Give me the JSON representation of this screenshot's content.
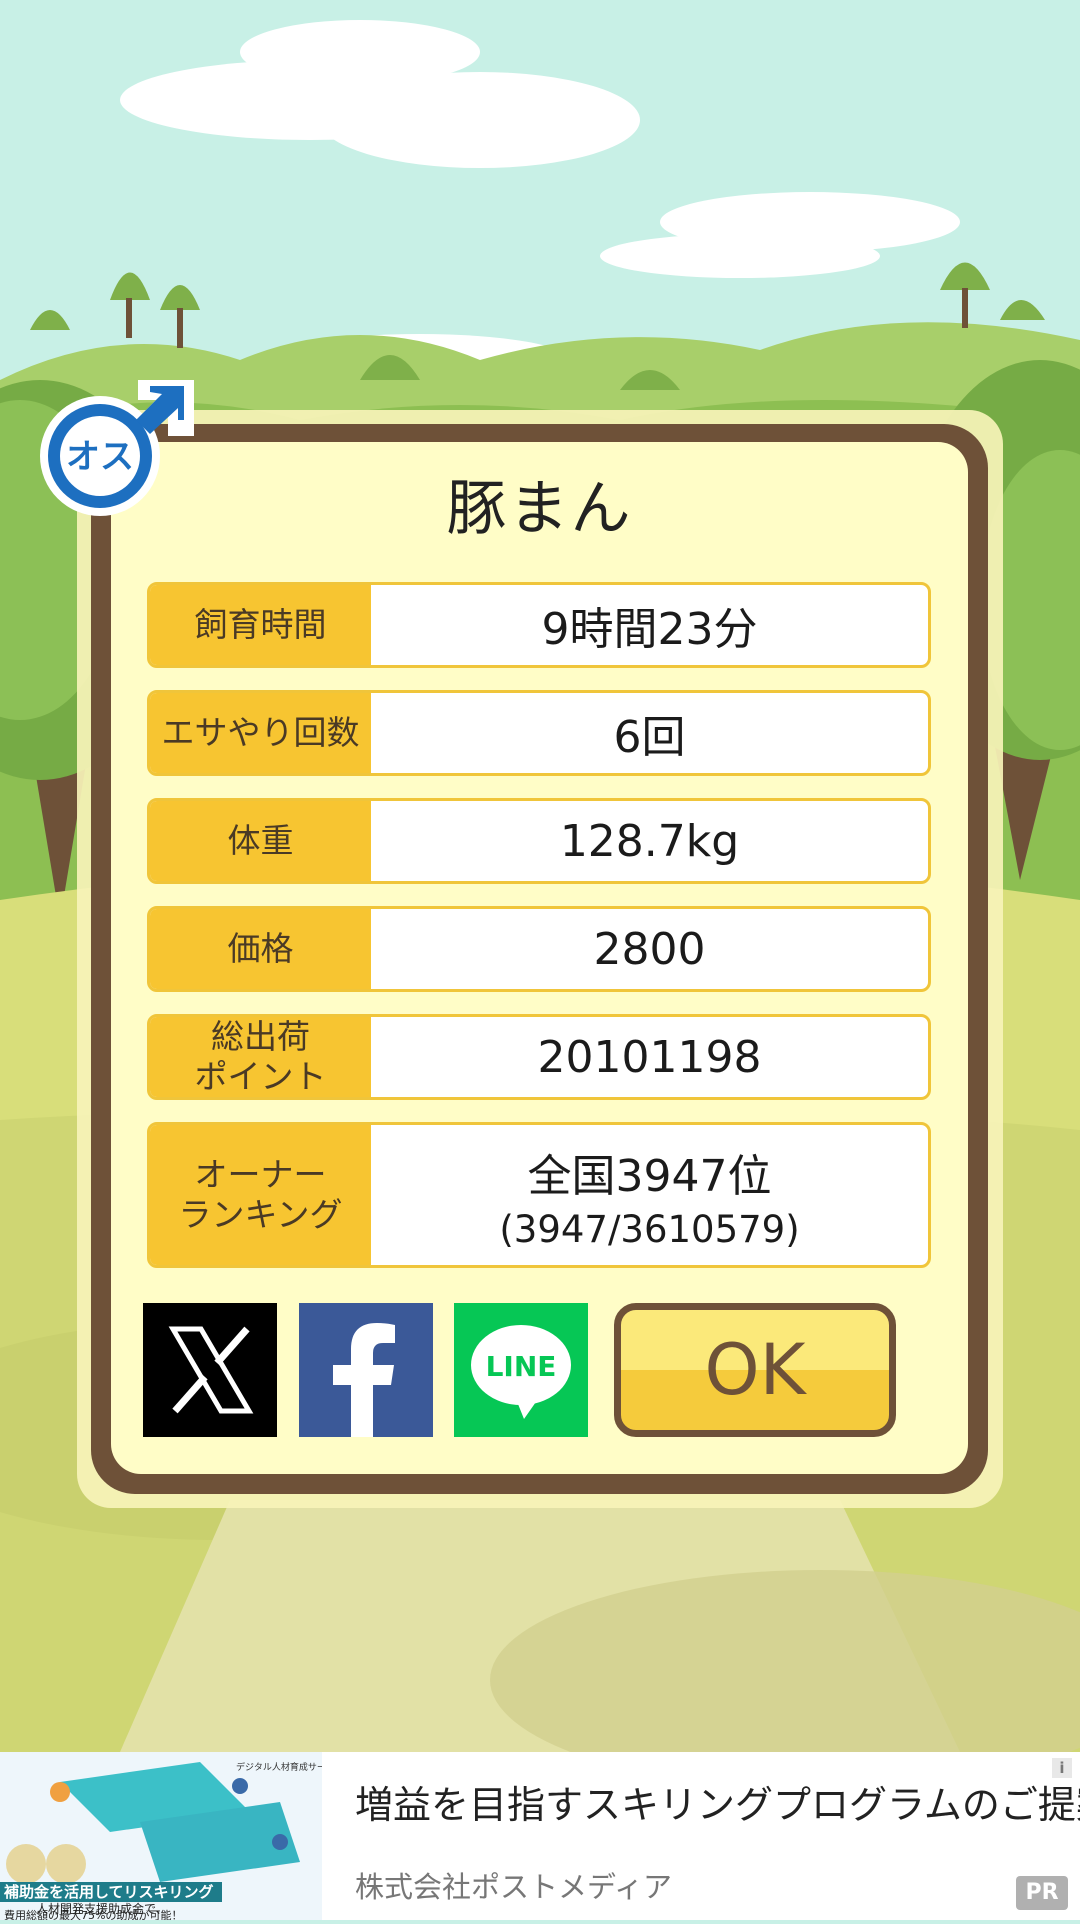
{
  "pig": {
    "name": "豚まん",
    "sex_label": "オス"
  },
  "stats": [
    {
      "label": "飼育時間",
      "value": "9時間23分"
    },
    {
      "label": "エサやり回数",
      "value": "6回"
    },
    {
      "label": "体重",
      "value": "128.7kg"
    },
    {
      "label": "価格",
      "value": "2800"
    },
    {
      "label_line1": "総出荷",
      "label_line2": "ポイント",
      "value": "20101198"
    },
    {
      "label_line1": "オーナー",
      "label_line2": "ランキング",
      "value": "全国3947位",
      "value_sub": "(3947/3610579)"
    }
  ],
  "share": {
    "x_label": "X",
    "facebook_label": "f",
    "line_label": "LINE"
  },
  "ok_label": "OK",
  "ad": {
    "title": "増益を目指すスキリングプログラムのご提案",
    "sponsor": "株式会社ポストメディア",
    "badge": "PR",
    "info_icon": "i",
    "image_caption": "補助金を活用してリスキリング",
    "image_line2": "人材開発支援助成金で、",
    "image_line3": "費用総額の最大75%の助成が可能！",
    "image_tag": "デジタル人材育成サービス"
  },
  "colors": {
    "sky": "#c8f0e6",
    "frame": "#6e5138",
    "panel": "#fffdc7",
    "label_bg": "#f7c531",
    "row_border": "#f0c53a",
    "male_blue": "#1d6fc0",
    "line_green": "#06c755",
    "facebook_blue": "#3b5998"
  }
}
